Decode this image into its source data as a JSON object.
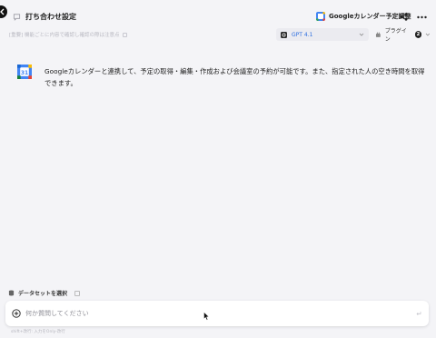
{
  "header": {
    "title": "打ち合わせ設定",
    "assistant_name": "Googleカレンダー予定調整"
  },
  "subbar": {
    "hint": "[重要] 機能ごとに内容で確認し確認の際は注意点",
    "model": "GPT 4.1",
    "plugin_label": "プラグイン",
    "plugin_count": "2"
  },
  "intro": {
    "text": "Googleカレンダーと連携して、予定の取得・編集・作成および会議室の予約が可能です。また、指定された人の空き時間を取得できます。"
  },
  "dataset": {
    "label": "データセットを選択"
  },
  "composer": {
    "placeholder": "何か質問してください"
  },
  "footer": {
    "note": "shift+改行: 入力をOnly-改行"
  },
  "colors": {
    "background": "#f4f4f7",
    "accent_blue": "#2e6fe0",
    "gcal_blue": "#4285f4",
    "gcal_green": "#34a853",
    "gcal_yellow": "#fbbc04",
    "gcal_red": "#ea4335"
  },
  "icons": [
    "back-icon",
    "chat-icon",
    "google-calendar-icon",
    "share-icon",
    "more-icon",
    "openai-icon",
    "plugin-icon",
    "database-icon",
    "info-icon",
    "add-icon",
    "send-icon",
    "cursor-icon"
  ]
}
